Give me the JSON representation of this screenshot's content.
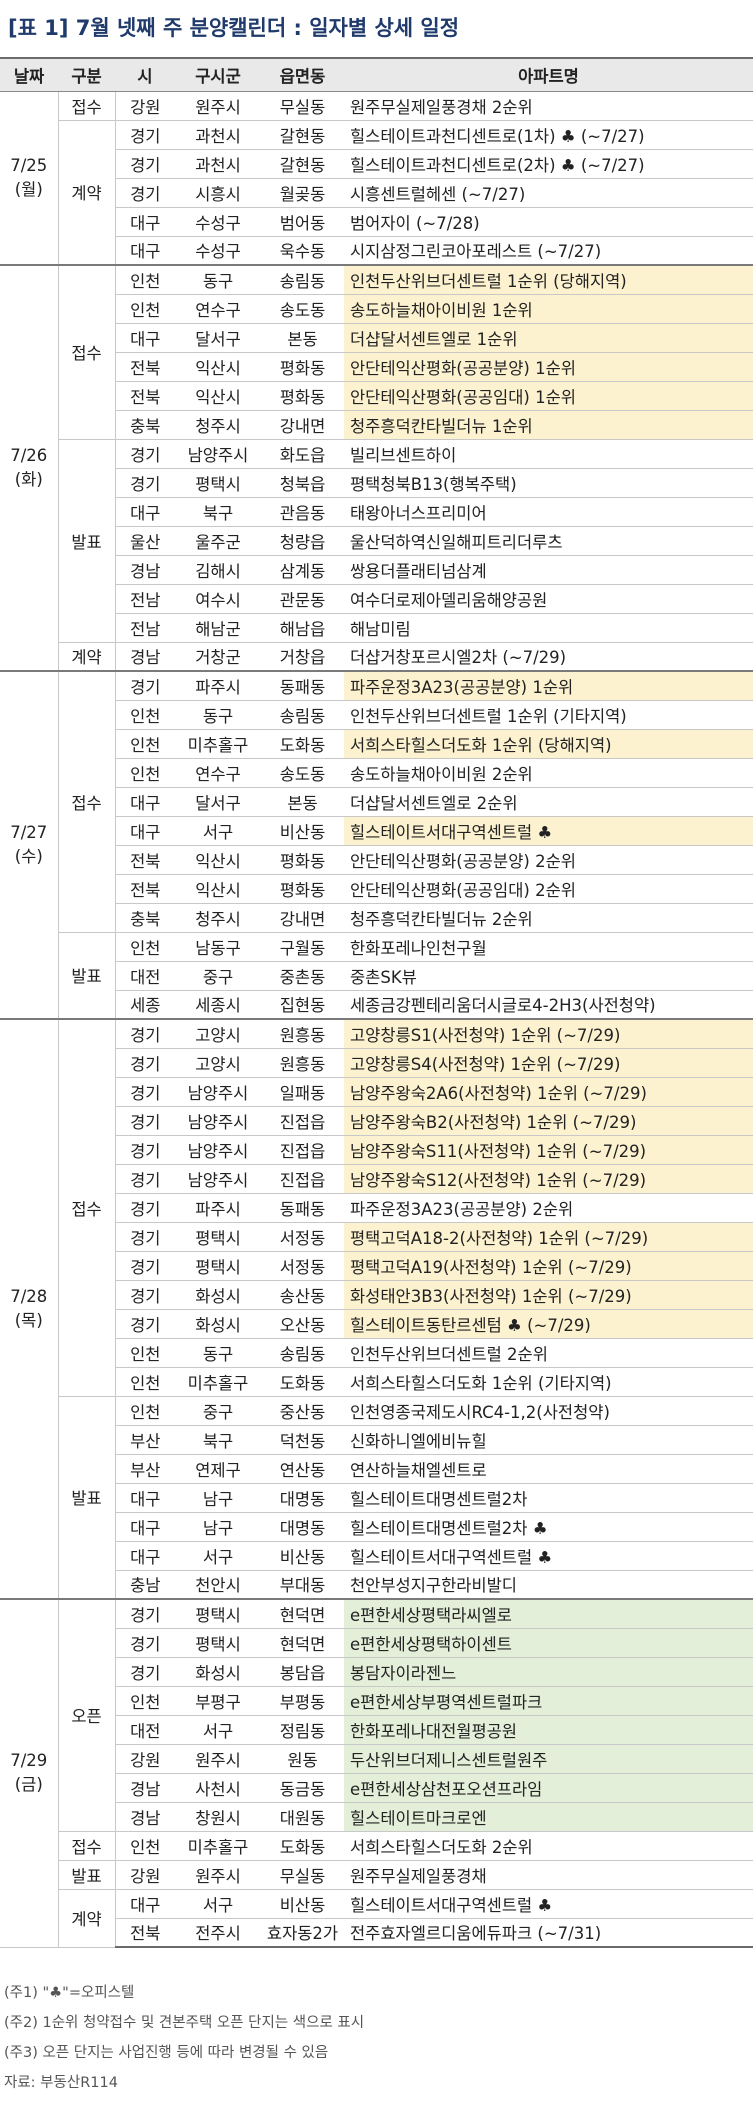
{
  "title": "[표 1] 7월 넷째 주 분양캘린더 : 일자별 상세 일정",
  "headers": [
    "날짜",
    "구분",
    "시",
    "구시군",
    "읍면동",
    "아파트명"
  ],
  "highlight_colors": {
    "yellow": "#fdf2d0",
    "green": "#e4efd9"
  },
  "days": [
    {
      "date": "7/25\n(월)",
      "groups": [
        {
          "cat": "접수",
          "rows": [
            {
              "sido": "강원",
              "sgg": "원주시",
              "emd": "무실동",
              "apt": "원주무실제일풍경채 2순위",
              "hl": ""
            }
          ]
        },
        {
          "cat": "계약",
          "rows": [
            {
              "sido": "경기",
              "sgg": "과천시",
              "emd": "갈현동",
              "apt": "힐스테이트과천디센트로(1차) ♣ (~7/27)",
              "hl": ""
            },
            {
              "sido": "경기",
              "sgg": "과천시",
              "emd": "갈현동",
              "apt": "힐스테이트과천디센트로(2차) ♣ (~7/27)",
              "hl": ""
            },
            {
              "sido": "경기",
              "sgg": "시흥시",
              "emd": "월곶동",
              "apt": "시흥센트럴헤센 (~7/27)",
              "hl": ""
            },
            {
              "sido": "대구",
              "sgg": "수성구",
              "emd": "범어동",
              "apt": "범어자이 (~7/28)",
              "hl": ""
            },
            {
              "sido": "대구",
              "sgg": "수성구",
              "emd": "욱수동",
              "apt": "시지삼정그린코아포레스트 (~7/27)",
              "hl": ""
            }
          ]
        }
      ]
    },
    {
      "date": "7/26\n(화)",
      "groups": [
        {
          "cat": "접수",
          "rows": [
            {
              "sido": "인천",
              "sgg": "동구",
              "emd": "송림동",
              "apt": "인천두산위브더센트럴 1순위 (당해지역)",
              "hl": "y"
            },
            {
              "sido": "인천",
              "sgg": "연수구",
              "emd": "송도동",
              "apt": "송도하늘채아이비원 1순위",
              "hl": "y"
            },
            {
              "sido": "대구",
              "sgg": "달서구",
              "emd": "본동",
              "apt": "더샵달서센트엘로 1순위",
              "hl": "y"
            },
            {
              "sido": "전북",
              "sgg": "익산시",
              "emd": "평화동",
              "apt": "안단테익산평화(공공분양) 1순위",
              "hl": "y"
            },
            {
              "sido": "전북",
              "sgg": "익산시",
              "emd": "평화동",
              "apt": "안단테익산평화(공공임대) 1순위",
              "hl": "y"
            },
            {
              "sido": "충북",
              "sgg": "청주시",
              "emd": "강내면",
              "apt": "청주흥덕칸타빌더뉴 1순위",
              "hl": "y"
            }
          ]
        },
        {
          "cat": "발표",
          "rows": [
            {
              "sido": "경기",
              "sgg": "남양주시",
              "emd": "화도읍",
              "apt": "빌리브센트하이",
              "hl": ""
            },
            {
              "sido": "경기",
              "sgg": "평택시",
              "emd": "청북읍",
              "apt": "평택청북B13(행복주택)",
              "hl": ""
            },
            {
              "sido": "대구",
              "sgg": "북구",
              "emd": "관음동",
              "apt": "태왕아너스프리미어",
              "hl": ""
            },
            {
              "sido": "울산",
              "sgg": "울주군",
              "emd": "청량읍",
              "apt": "울산덕하역신일해피트리더루츠",
              "hl": ""
            },
            {
              "sido": "경남",
              "sgg": "김해시",
              "emd": "삼계동",
              "apt": "쌍용더플래티넘삼계",
              "hl": ""
            },
            {
              "sido": "전남",
              "sgg": "여수시",
              "emd": "관문동",
              "apt": "여수더로제아델리움해양공원",
              "hl": ""
            },
            {
              "sido": "전남",
              "sgg": "해남군",
              "emd": "해남읍",
              "apt": "해남미림",
              "hl": ""
            }
          ]
        },
        {
          "cat": "계약",
          "rows": [
            {
              "sido": "경남",
              "sgg": "거창군",
              "emd": "거창읍",
              "apt": "더샵거창포르시엘2차 (~7/29)",
              "hl": ""
            }
          ]
        }
      ]
    },
    {
      "date": "7/27\n(수)",
      "groups": [
        {
          "cat": "접수",
          "rows": [
            {
              "sido": "경기",
              "sgg": "파주시",
              "emd": "동패동",
              "apt": "파주운정3A23(공공분양) 1순위",
              "hl": "y"
            },
            {
              "sido": "인천",
              "sgg": "동구",
              "emd": "송림동",
              "apt": "인천두산위브더센트럴 1순위 (기타지역)",
              "hl": ""
            },
            {
              "sido": "인천",
              "sgg": "미추홀구",
              "emd": "도화동",
              "apt": "서희스타힐스더도화 1순위 (당해지역)",
              "hl": "y"
            },
            {
              "sido": "인천",
              "sgg": "연수구",
              "emd": "송도동",
              "apt": "송도하늘채아이비원 2순위",
              "hl": ""
            },
            {
              "sido": "대구",
              "sgg": "달서구",
              "emd": "본동",
              "apt": "더샵달서센트엘로 2순위",
              "hl": ""
            },
            {
              "sido": "대구",
              "sgg": "서구",
              "emd": "비산동",
              "apt": "힐스테이트서대구역센트럴 ♣",
              "hl": "y"
            },
            {
              "sido": "전북",
              "sgg": "익산시",
              "emd": "평화동",
              "apt": "안단테익산평화(공공분양) 2순위",
              "hl": ""
            },
            {
              "sido": "전북",
              "sgg": "익산시",
              "emd": "평화동",
              "apt": "안단테익산평화(공공임대) 2순위",
              "hl": ""
            },
            {
              "sido": "충북",
              "sgg": "청주시",
              "emd": "강내면",
              "apt": "청주흥덕칸타빌더뉴 2순위",
              "hl": ""
            }
          ]
        },
        {
          "cat": "발표",
          "rows": [
            {
              "sido": "인천",
              "sgg": "남동구",
              "emd": "구월동",
              "apt": "한화포레나인천구월",
              "hl": ""
            },
            {
              "sido": "대전",
              "sgg": "중구",
              "emd": "중촌동",
              "apt": "중촌SK뷰",
              "hl": ""
            },
            {
              "sido": "세종",
              "sgg": "세종시",
              "emd": "집현동",
              "apt": "세종금강펜테리움더시글로4-2H3(사전청약)",
              "hl": ""
            }
          ]
        }
      ]
    },
    {
      "date": "7/28\n(목)",
      "groups": [
        {
          "cat": "접수",
          "rows": [
            {
              "sido": "경기",
              "sgg": "고양시",
              "emd": "원흥동",
              "apt": "고양창릉S1(사전청약) 1순위 (~7/29)",
              "hl": "y"
            },
            {
              "sido": "경기",
              "sgg": "고양시",
              "emd": "원흥동",
              "apt": "고양창릉S4(사전청약) 1순위 (~7/29)",
              "hl": "y"
            },
            {
              "sido": "경기",
              "sgg": "남양주시",
              "emd": "일패동",
              "apt": "남양주왕숙2A6(사전청약) 1순위 (~7/29)",
              "hl": "y"
            },
            {
              "sido": "경기",
              "sgg": "남양주시",
              "emd": "진접읍",
              "apt": "남양주왕숙B2(사전청약) 1순위 (~7/29)",
              "hl": "y"
            },
            {
              "sido": "경기",
              "sgg": "남양주시",
              "emd": "진접읍",
              "apt": "남양주왕숙S11(사전청약) 1순위 (~7/29)",
              "hl": "y"
            },
            {
              "sido": "경기",
              "sgg": "남양주시",
              "emd": "진접읍",
              "apt": "남양주왕숙S12(사전청약) 1순위 (~7/29)",
              "hl": "y"
            },
            {
              "sido": "경기",
              "sgg": "파주시",
              "emd": "동패동",
              "apt": "파주운정3A23(공공분양) 2순위",
              "hl": ""
            },
            {
              "sido": "경기",
              "sgg": "평택시",
              "emd": "서정동",
              "apt": "평택고덕A18-2(사전청약) 1순위 (~7/29)",
              "hl": "y"
            },
            {
              "sido": "경기",
              "sgg": "평택시",
              "emd": "서정동",
              "apt": "평택고덕A19(사전청약) 1순위 (~7/29)",
              "hl": "y"
            },
            {
              "sido": "경기",
              "sgg": "화성시",
              "emd": "송산동",
              "apt": "화성태안3B3(사전청약) 1순위 (~7/29)",
              "hl": "y"
            },
            {
              "sido": "경기",
              "sgg": "화성시",
              "emd": "오산동",
              "apt": "힐스테이트동탄르센텀 ♣ (~7/29)",
              "hl": "y"
            },
            {
              "sido": "인천",
              "sgg": "동구",
              "emd": "송림동",
              "apt": "인천두산위브더센트럴 2순위",
              "hl": ""
            },
            {
              "sido": "인천",
              "sgg": "미추홀구",
              "emd": "도화동",
              "apt": "서희스타힐스더도화 1순위 (기타지역)",
              "hl": ""
            }
          ]
        },
        {
          "cat": "발표",
          "rows": [
            {
              "sido": "인천",
              "sgg": "중구",
              "emd": "중산동",
              "apt": "인천영종국제도시RC4-1,2(사전청약)",
              "hl": ""
            },
            {
              "sido": "부산",
              "sgg": "북구",
              "emd": "덕천동",
              "apt": "신화하니엘에비뉴힐",
              "hl": ""
            },
            {
              "sido": "부산",
              "sgg": "연제구",
              "emd": "연산동",
              "apt": "연산하늘채엘센트로",
              "hl": ""
            },
            {
              "sido": "대구",
              "sgg": "남구",
              "emd": "대명동",
              "apt": "힐스테이트대명센트럴2차",
              "hl": ""
            },
            {
              "sido": "대구",
              "sgg": "남구",
              "emd": "대명동",
              "apt": "힐스테이트대명센트럴2차 ♣",
              "hl": ""
            },
            {
              "sido": "대구",
              "sgg": "서구",
              "emd": "비산동",
              "apt": "힐스테이트서대구역센트럴 ♣",
              "hl": ""
            },
            {
              "sido": "충남",
              "sgg": "천안시",
              "emd": "부대동",
              "apt": "천안부성지구한라비발디",
              "hl": ""
            }
          ]
        }
      ]
    },
    {
      "date": "7/29\n(금)",
      "groups": [
        {
          "cat": "오픈",
          "rows": [
            {
              "sido": "경기",
              "sgg": "평택시",
              "emd": "현덕면",
              "apt": "e편한세상평택라씨엘로",
              "hl": "g"
            },
            {
              "sido": "경기",
              "sgg": "평택시",
              "emd": "현덕면",
              "apt": "e편한세상평택하이센트",
              "hl": "g"
            },
            {
              "sido": "경기",
              "sgg": "화성시",
              "emd": "봉담읍",
              "apt": "봉담자이라젠느",
              "hl": "g"
            },
            {
              "sido": "인천",
              "sgg": "부평구",
              "emd": "부평동",
              "apt": "e편한세상부평역센트럴파크",
              "hl": "g"
            },
            {
              "sido": "대전",
              "sgg": "서구",
              "emd": "정림동",
              "apt": "한화포레나대전월평공원",
              "hl": "g"
            },
            {
              "sido": "강원",
              "sgg": "원주시",
              "emd": "원동",
              "apt": "두산위브더제니스센트럴원주",
              "hl": "g"
            },
            {
              "sido": "경남",
              "sgg": "사천시",
              "emd": "동금동",
              "apt": "e편한세상삼천포오션프라임",
              "hl": "g"
            },
            {
              "sido": "경남",
              "sgg": "창원시",
              "emd": "대원동",
              "apt": "힐스테이트마크로엔",
              "hl": "g"
            }
          ]
        },
        {
          "cat": "접수",
          "rows": [
            {
              "sido": "인천",
              "sgg": "미추홀구",
              "emd": "도화동",
              "apt": "서희스타힐스더도화 2순위",
              "hl": ""
            }
          ]
        },
        {
          "cat": "발표",
          "rows": [
            {
              "sido": "강원",
              "sgg": "원주시",
              "emd": "무실동",
              "apt": "원주무실제일풍경채",
              "hl": ""
            }
          ]
        },
        {
          "cat": "계약",
          "rows": [
            {
              "sido": "대구",
              "sgg": "서구",
              "emd": "비산동",
              "apt": "힐스테이트서대구역센트럴 ♣",
              "hl": ""
            },
            {
              "sido": "전북",
              "sgg": "전주시",
              "emd": "효자동2가",
              "apt": "전주효자엘르디움에듀파크 (~7/31)",
              "hl": ""
            }
          ]
        }
      ]
    }
  ],
  "notes": [
    "(주1) \"♣\"=오피스텔",
    "(주2) 1순위 청약접수 및 견본주택 오픈 단지는 색으로  표시",
    "(주3) 오픈 단지는 사업진행 등에 따라 변경될 수 있음",
    "자료: 부동산R114"
  ]
}
